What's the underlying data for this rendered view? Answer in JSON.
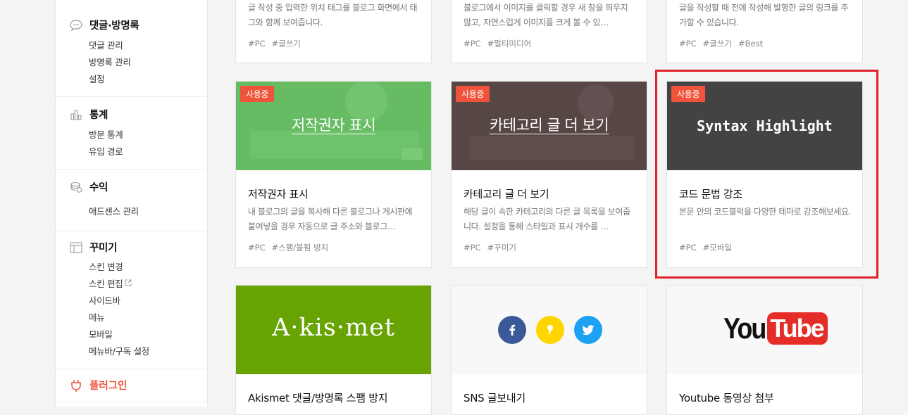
{
  "sidebar": {
    "comments": {
      "title": "댓글·방명록",
      "items": [
        "댓글 관리",
        "방명록 관리",
        "설정"
      ]
    },
    "stats": {
      "title": "통계",
      "items": [
        "방문 통계",
        "유입 경로"
      ]
    },
    "revenue": {
      "title": "수익",
      "items": [
        "애드센스 관리"
      ]
    },
    "design": {
      "title": "꾸미기",
      "items": [
        "스킨 변경",
        "스킨 편집",
        "사이드바",
        "메뉴",
        "모바일",
        "메뉴바/구독 설정"
      ]
    },
    "plugin": {
      "title": "플러그인"
    }
  },
  "cards": [
    {
      "desc": "글 작성 중 입력한 위치 태그를 블로그 화면에서 태그와 함께 보여줍니다.",
      "tags": [
        "#PC",
        "#글쓰기"
      ]
    },
    {
      "desc": "블로그에서 이미지를 클릭할 경우 새 창을 띄우지 않고, 자연스럽게 이미지를 크게 볼 수 있…",
      "tags": [
        "#PC",
        "#멀티미디어"
      ]
    },
    {
      "desc": "글을 작성할 때 전에 작성해 발행한 글의 링크를 추가할 수 있습니다.",
      "tags": [
        "#PC",
        "#글쓰기",
        "#Best"
      ]
    },
    {
      "badge": "사용중",
      "thumb_title": "저작권자 표시",
      "name": "저작권자 표시",
      "desc": "내 블로그의 글을 복사해 다른 블로그나 게시판에 붙여넣을 경우 자동으로 글 주소와 블로그…",
      "tags": [
        "#PC",
        "#스팸/블펌 방지"
      ]
    },
    {
      "badge": "사용중",
      "thumb_title": "카테고리 글 더 보기",
      "name": "카테고리 글 더 보기",
      "desc": "해당 글이 속한 카테고리의 다른 글 목록을 보여줍니다. 설정을 통해 스타일과 표시 개수를 …",
      "tags": [
        "#PC",
        "#꾸미기"
      ]
    },
    {
      "badge": "사용중",
      "thumb_title": "Syntax Highlight",
      "name": "코드 문법 강조",
      "desc": "본문 안의 코드블럭을 다양한 테마로 강조해보세요.",
      "tags": [
        "#PC",
        "#모바일"
      ]
    },
    {
      "thumb_title": "A·kis·met",
      "name": "Akismet 댓글/방명록 스팸 방지"
    },
    {
      "name": "SNS 글보내기"
    },
    {
      "thumb_logo_you": "You",
      "thumb_logo_tube": "Tube",
      "name": "Youtube 동영상 첨부"
    }
  ],
  "colors": {
    "accent": "#f0533b",
    "highlight": "#e0202a",
    "akismet": "#66a303",
    "facebook": "#3b5998",
    "kakao": "#ffd600",
    "twitter": "#1da1f2"
  }
}
